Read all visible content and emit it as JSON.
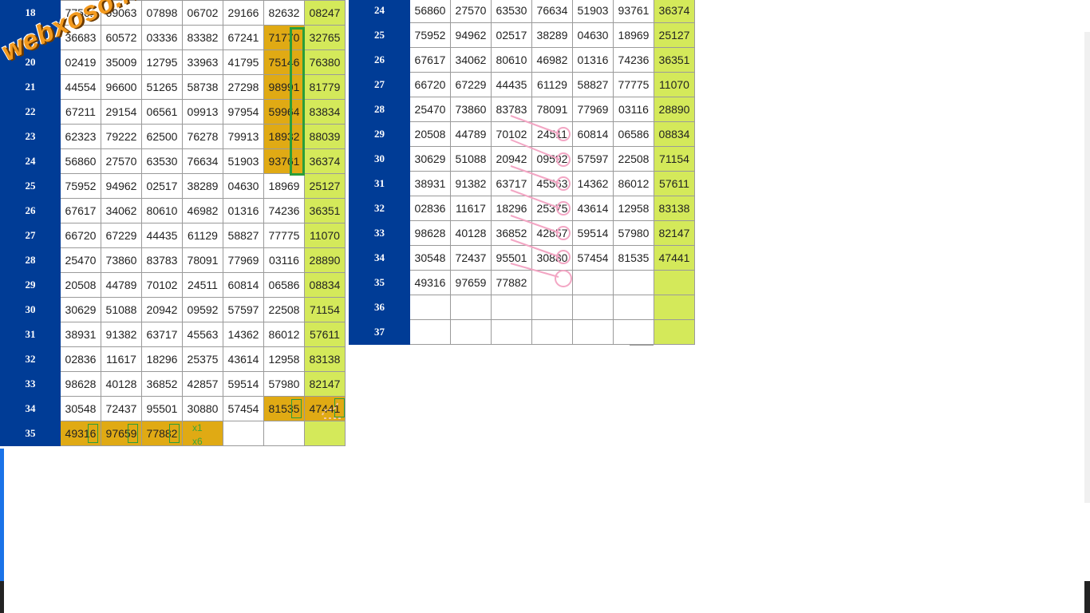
{
  "watermark": "webxoso.net",
  "colors": {
    "index_bg": "#003c96",
    "last_col_bg": "#d4e95a",
    "highlight_bg": "#e0aa14",
    "box_border": "#2a9e3a",
    "pen_pink": "#f3a6c4"
  },
  "left_table": {
    "rows": [
      {
        "idx": "18",
        "cells": [
          "77561",
          "69063",
          "07898",
          "06702",
          "29166",
          "82632",
          "08247"
        ]
      },
      {
        "idx": "19",
        "cells": [
          "36683",
          "60572",
          "03336",
          "83382",
          "67241",
          "71770",
          "32765"
        ]
      },
      {
        "idx": "20",
        "cells": [
          "02419",
          "35009",
          "12795",
          "33963",
          "41795",
          "75146",
          "76380"
        ]
      },
      {
        "idx": "21",
        "cells": [
          "44554",
          "96600",
          "51265",
          "58738",
          "27298",
          "98991",
          "81779"
        ]
      },
      {
        "idx": "22",
        "cells": [
          "67211",
          "29154",
          "06561",
          "09913",
          "97954",
          "59964",
          "83834"
        ]
      },
      {
        "idx": "23",
        "cells": [
          "62323",
          "79222",
          "62500",
          "76278",
          "79913",
          "18932",
          "88039"
        ]
      },
      {
        "idx": "24",
        "cells": [
          "56860",
          "27570",
          "63530",
          "76634",
          "51903",
          "93761",
          "36374"
        ]
      },
      {
        "idx": "25",
        "cells": [
          "75952",
          "94962",
          "02517",
          "38289",
          "04630",
          "18969",
          "25127"
        ]
      },
      {
        "idx": "26",
        "cells": [
          "67617",
          "34062",
          "80610",
          "46982",
          "01316",
          "74236",
          "36351"
        ]
      },
      {
        "idx": "27",
        "cells": [
          "66720",
          "67229",
          "44435",
          "61129",
          "58827",
          "77775",
          "11070"
        ]
      },
      {
        "idx": "28",
        "cells": [
          "25470",
          "73860",
          "83783",
          "78091",
          "77969",
          "03116",
          "28890"
        ]
      },
      {
        "idx": "29",
        "cells": [
          "20508",
          "44789",
          "70102",
          "24511",
          "60814",
          "06586",
          "08834"
        ]
      },
      {
        "idx": "30",
        "cells": [
          "30629",
          "51088",
          "20942",
          "09592",
          "57597",
          "22508",
          "71154"
        ]
      },
      {
        "idx": "31",
        "cells": [
          "38931",
          "91382",
          "63717",
          "45563",
          "14362",
          "86012",
          "57611"
        ]
      },
      {
        "idx": "32",
        "cells": [
          "02836",
          "11617",
          "18296",
          "25375",
          "43614",
          "12958",
          "83138"
        ]
      },
      {
        "idx": "33",
        "cells": [
          "98628",
          "40128",
          "36852",
          "42857",
          "59514",
          "57980",
          "82147"
        ]
      },
      {
        "idx": "34",
        "cells": [
          "30548",
          "72437",
          "95501",
          "30880",
          "57454",
          "81535",
          "47441"
        ]
      },
      {
        "idx": "35",
        "cells": [
          "49316",
          "97659",
          "77882",
          "",
          "",
          "",
          ""
        ]
      }
    ],
    "multipliers": [
      "x1",
      "x6"
    ]
  },
  "right_table": {
    "rows": [
      {
        "idx": "24",
        "cells": [
          "56860",
          "27570",
          "63530",
          "76634",
          "51903",
          "93761",
          "36374"
        ]
      },
      {
        "idx": "25",
        "cells": [
          "75952",
          "94962",
          "02517",
          "38289",
          "04630",
          "18969",
          "25127"
        ]
      },
      {
        "idx": "26",
        "cells": [
          "67617",
          "34062",
          "80610",
          "46982",
          "01316",
          "74236",
          "36351"
        ]
      },
      {
        "idx": "27",
        "cells": [
          "66720",
          "67229",
          "44435",
          "61129",
          "58827",
          "77775",
          "11070"
        ]
      },
      {
        "idx": "28",
        "cells": [
          "25470",
          "73860",
          "83783",
          "78091",
          "77969",
          "03116",
          "28890"
        ]
      },
      {
        "idx": "29",
        "cells": [
          "20508",
          "44789",
          "70102",
          "24511",
          "60814",
          "06586",
          "08834"
        ]
      },
      {
        "idx": "30",
        "cells": [
          "30629",
          "51088",
          "20942",
          "09592",
          "57597",
          "22508",
          "71154"
        ]
      },
      {
        "idx": "31",
        "cells": [
          "38931",
          "91382",
          "63717",
          "45563",
          "14362",
          "86012",
          "57611"
        ]
      },
      {
        "idx": "32",
        "cells": [
          "02836",
          "11617",
          "18296",
          "25375",
          "43614",
          "12958",
          "83138"
        ]
      },
      {
        "idx": "33",
        "cells": [
          "98628",
          "40128",
          "36852",
          "42857",
          "59514",
          "57980",
          "82147"
        ]
      },
      {
        "idx": "34",
        "cells": [
          "30548",
          "72437",
          "95501",
          "30880",
          "57454",
          "81535",
          "47441"
        ]
      },
      {
        "idx": "35",
        "cells": [
          "49316",
          "97659",
          "77882",
          "",
          "",
          "",
          ""
        ]
      },
      {
        "idx": "36",
        "cells": [
          "",
          "",
          "",
          "",
          "",
          "",
          ""
        ]
      },
      {
        "idx": "37",
        "cells": [
          "",
          "",
          "",
          "",
          "",
          "",
          ""
        ]
      }
    ]
  }
}
